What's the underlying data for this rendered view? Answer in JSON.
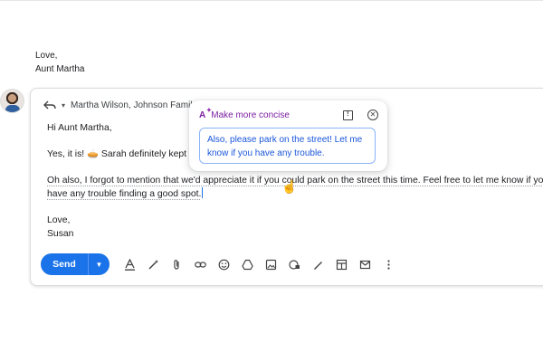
{
  "previous_message": {
    "line1": "Love,",
    "line2": "Aunt Martha"
  },
  "compose": {
    "recipients": "Martha Wilson, Johnson Famil",
    "greeting": "Hi Aunt Martha,",
    "line_yes": "Yes, it is! 🥧 Sarah definitely kept Ti",
    "line_oh_part1": "Oh also, I forgot to mention that we'd appreciate it if you could park on the street this time. Feel free to let me know if you",
    "line_oh_part2": "have any trouble finding a good spot.",
    "signoff": "Love,",
    "signature": "Susan"
  },
  "ai_popup": {
    "title": "Make more concise",
    "suggestion": "Also, please park on the street! Let me know if you have any trouble."
  },
  "toolbar": {
    "send_label": "Send",
    "icons": [
      "format-text-icon",
      "magic-pen-icon",
      "attach-icon",
      "link-icon",
      "emoji-icon",
      "drive-icon",
      "photo-icon",
      "confidential-icon",
      "signature-icon",
      "layout-icon",
      "schedule-icon",
      "more-vert-icon"
    ]
  }
}
